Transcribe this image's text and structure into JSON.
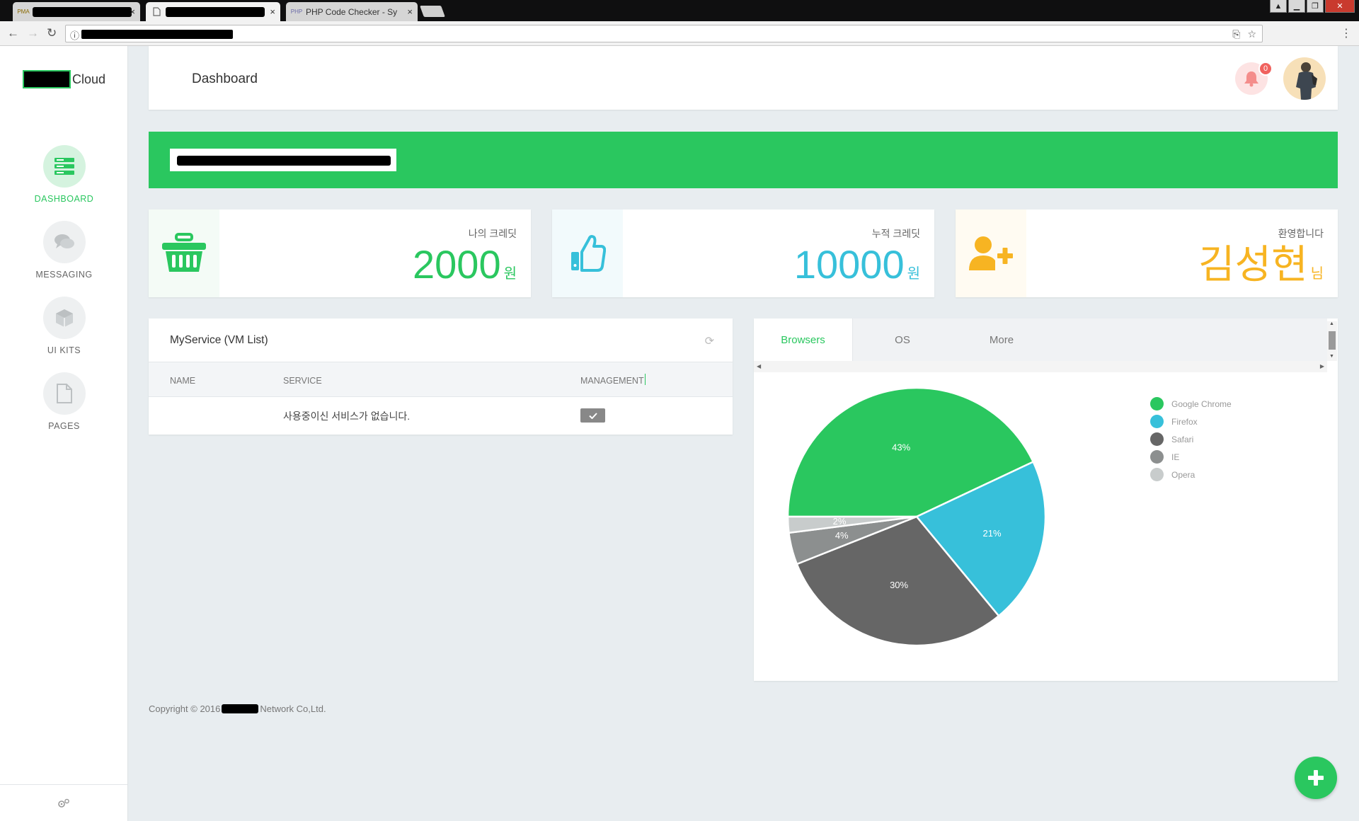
{
  "browser": {
    "tabs": [
      {
        "favicon": "PMA",
        "title": ""
      },
      {
        "favicon": "page-icon",
        "title": ""
      },
      {
        "favicon": "PHP",
        "title": "PHP Code Checker - Sy"
      }
    ],
    "close_glyph": "×"
  },
  "app": {
    "logo_text": "Cloud"
  },
  "sidebar": {
    "items": [
      {
        "label": "DASHBOARD",
        "icon": "dashboard-icon",
        "active": true
      },
      {
        "label": "MESSAGING",
        "icon": "chat-icon",
        "active": false
      },
      {
        "label": "UI KITS",
        "icon": "cube-icon",
        "active": false
      },
      {
        "label": "PAGES",
        "icon": "file-icon",
        "active": false
      }
    ]
  },
  "header": {
    "title": "Dashboard",
    "notification_count": "0"
  },
  "stats": [
    {
      "label": "나의 크레딧",
      "value": "2000",
      "unit": "원",
      "color": "#2ac75f",
      "icon": "basket-icon",
      "icon_bg": "#f4fbf6"
    },
    {
      "label": "누적 크레딧",
      "value": "10000",
      "unit": "원",
      "color": "#37c0da",
      "icon": "thumbs-up-icon",
      "icon_bg": "#f2fafc"
    },
    {
      "label": "환영합니다",
      "value": "김성현",
      "unit": "님",
      "color": "#f7b422",
      "icon": "user-add-icon",
      "icon_bg": "#fffbf2"
    }
  ],
  "service": {
    "title": "MyService (VM List)",
    "columns": [
      "NAME",
      "SERVICE",
      "MANAGEMENT"
    ],
    "empty_message": "사용중이신 서비스가 없습니다."
  },
  "chart_tabs": [
    {
      "label": "Browsers",
      "active": true
    },
    {
      "label": "OS",
      "active": false
    },
    {
      "label": "More",
      "active": false
    }
  ],
  "chart_data": {
    "type": "pie",
    "series": [
      {
        "name": "Google Chrome",
        "value": 43,
        "label": "43%",
        "color": "#2ac75f"
      },
      {
        "name": "Firefox",
        "value": 21,
        "label": "21%",
        "color": "#37c0da"
      },
      {
        "name": "Safari",
        "value": 30,
        "label": "30%",
        "color": "#666666"
      },
      {
        "name": "IE",
        "value": 4,
        "label": "4%",
        "color": "#8c8f8f"
      },
      {
        "name": "Opera",
        "value": 2,
        "label": "2%",
        "color": "#c8cccc"
      }
    ],
    "legend_position": "right"
  },
  "footer": {
    "copyright_prefix": "Copyright © 2016",
    "copyright_suffix": "Network Co,Ltd."
  }
}
